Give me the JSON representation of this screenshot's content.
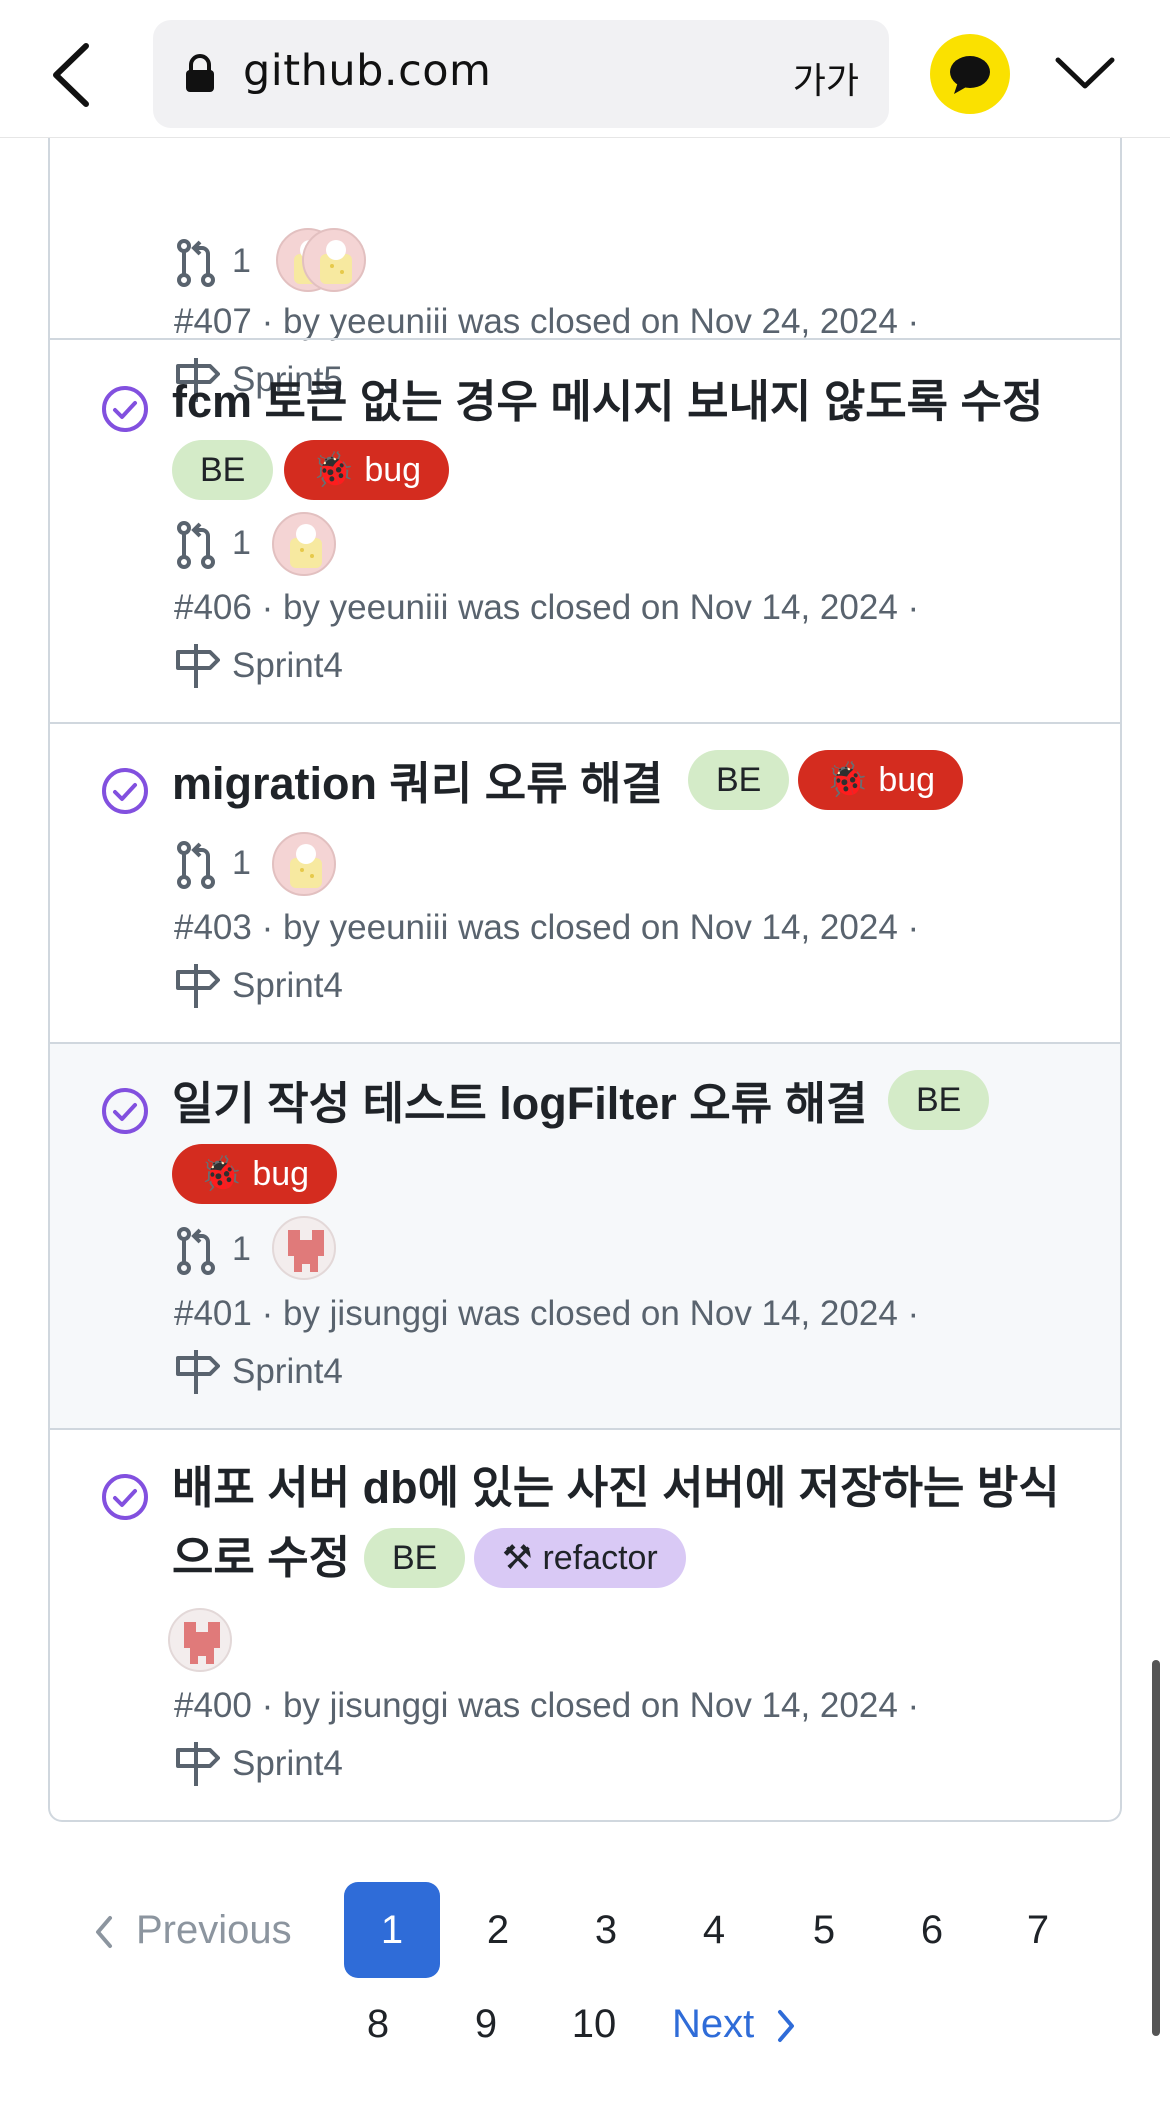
{
  "browser": {
    "url": "github.com",
    "font_size_label": "가가"
  },
  "issues": [
    {
      "pr_count": "1",
      "meta": "#407 · by yeeuniii was closed on Nov 24, 2024 ·",
      "milestone": "Sprint5"
    },
    {
      "title": "fcm 토큰 없는 경우 메시지 보내지 않도록 수정",
      "labels": [
        "BE",
        "bug"
      ],
      "pr_count": "1",
      "meta": "#406 · by yeeuniii was closed on Nov 14, 2024 ·",
      "milestone": "Sprint4"
    },
    {
      "title": "migration 쿼리 오류 해결",
      "labels": [
        "BE",
        "bug"
      ],
      "pr_count": "1",
      "meta": "#403 · by yeeuniii was closed on Nov 14, 2024 ·",
      "milestone": "Sprint4"
    },
    {
      "title": "일기 작성 테스트 logFilter 오류 해결",
      "labels": [
        "BE",
        "bug"
      ],
      "pr_count": "1",
      "meta": "#401 · by jisunggi was closed on Nov 14, 2024 ·",
      "milestone": "Sprint4"
    },
    {
      "title_line1": "배포 서버 db에 있는 사진 서버에 저장하는 방식",
      "title_line2": "으로 수정",
      "labels": [
        "BE",
        "refactor"
      ],
      "meta": "#400 · by jisunggi was closed on Nov 14, 2024 ·",
      "milestone": "Sprint4"
    }
  ],
  "label_emoji": {
    "bug": "🐞",
    "refactor": "⚒"
  },
  "pagination": {
    "previous": "Previous",
    "pages": [
      "1",
      "2",
      "3",
      "4",
      "5",
      "6",
      "7",
      "8",
      "9",
      "10"
    ],
    "current": "1",
    "next": "Next"
  },
  "colors": {
    "label_be": "#d4ebc8",
    "label_bug": "#d42c1f",
    "label_refactor": "#d9c9f5",
    "closed_icon": "#8250df",
    "accent": "#2f6cd8"
  },
  "icons": {
    "back": "chevron-left-icon",
    "lock": "lock-icon",
    "kakao": "chat-bubble-icon",
    "expand": "chevron-down-icon",
    "closed": "issue-closed-icon",
    "pull_request": "git-pull-request-icon",
    "milestone": "milestone-icon"
  }
}
